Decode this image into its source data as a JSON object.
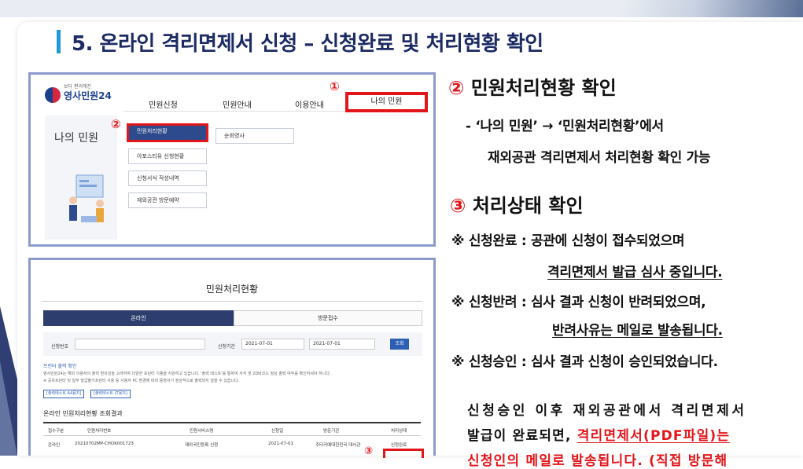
{
  "heading": "5. 온라인 격리면제서 신청 – 신청완료 및 처리현황 확인",
  "shot1": {
    "logo_small": "보다 편리해진",
    "logo_name": "영사민원24",
    "nav": [
      "민원신청",
      "민원안내",
      "이용안내",
      "나의 민원"
    ],
    "marker1": "①",
    "marker2": "②",
    "side_title": "나의 민원",
    "menu": [
      "민원처리현황",
      "아포스티유 신청현황",
      "신청서식 작성내역",
      "재외공관 방문예약"
    ],
    "menu_right": "순회영사"
  },
  "shot2": {
    "title": "민원처리현황",
    "tab_online": "온라인",
    "tab_visit": "방문접수",
    "label_no": "신청번호",
    "label_period": "신청기간",
    "date_from": "2021-07-01",
    "date_to": "2021-07-01",
    "search": "조회",
    "note_title": "프린터 출력 확인",
    "note1": "영사민원24는 해외 이용자의 출력 편의성을 고려하여 다양한 프린터 기종을 지원하고 있습니다. '출력 테스트'를 통하여 서식 및 2D바코드 정상 출력 여부를 확인하셔야 하니다.",
    "note2": "※ 공유프린터 및 일부 발급불가프린터 사용 등 사용자 PC 환경에 따라 증명서가 정상적으로 출력되지 않을 수 있습니다.",
    "chip1": "[출력테스트 A4용지]",
    "chip2": "[출력테스트 LT용지]",
    "result_title": "온라인 민원처리현황 조회결과",
    "headers": [
      "접수구분",
      "민원처리번호",
      "민원서비스명",
      "신청일",
      "방문기관",
      "처리상태"
    ],
    "row": [
      "온라인",
      "20210702MP-CHOK001723",
      "재외국민등록 신청",
      "2021-07-01",
      "주터키예대한민국 대사관",
      "신청완료"
    ],
    "marker3": "③"
  },
  "right": {
    "sec2_num": "②",
    "sec2_title": "민원처리현황 확인",
    "sec2_line1": "- ‘나의 민원’ → ‘민원처리현황’에서",
    "sec2_line2": "재외공관 격리면제서 처리현황 확인 가능",
    "sec3_num": "③",
    "sec3_title": "처리상태 확인",
    "s1_label": "※ 신청완료 : ",
    "s1_a": "공관에 신청이 접수되었으며",
    "s1_b": "격리면제서 발급 심사 중입니다.",
    "s2_label": "※ 신청반려 : ",
    "s2_a": "심사 결과 신청이 반려되었으며,",
    "s2_b": "반려사유는 메일로 발송됩니다.",
    "s3_label": "※ 신청승인 : ",
    "s3_a": "심사 결과 신청이 승인되었습니다.",
    "p1": "신청승인 이후 재외공관에서 격리면제서",
    "p2_a": "발급이 완료되면, ",
    "p2_b": "격리면제서(PDF파일)는",
    "p3": "신청인의 메일로 발송됩니다. (직접 방문해"
  }
}
